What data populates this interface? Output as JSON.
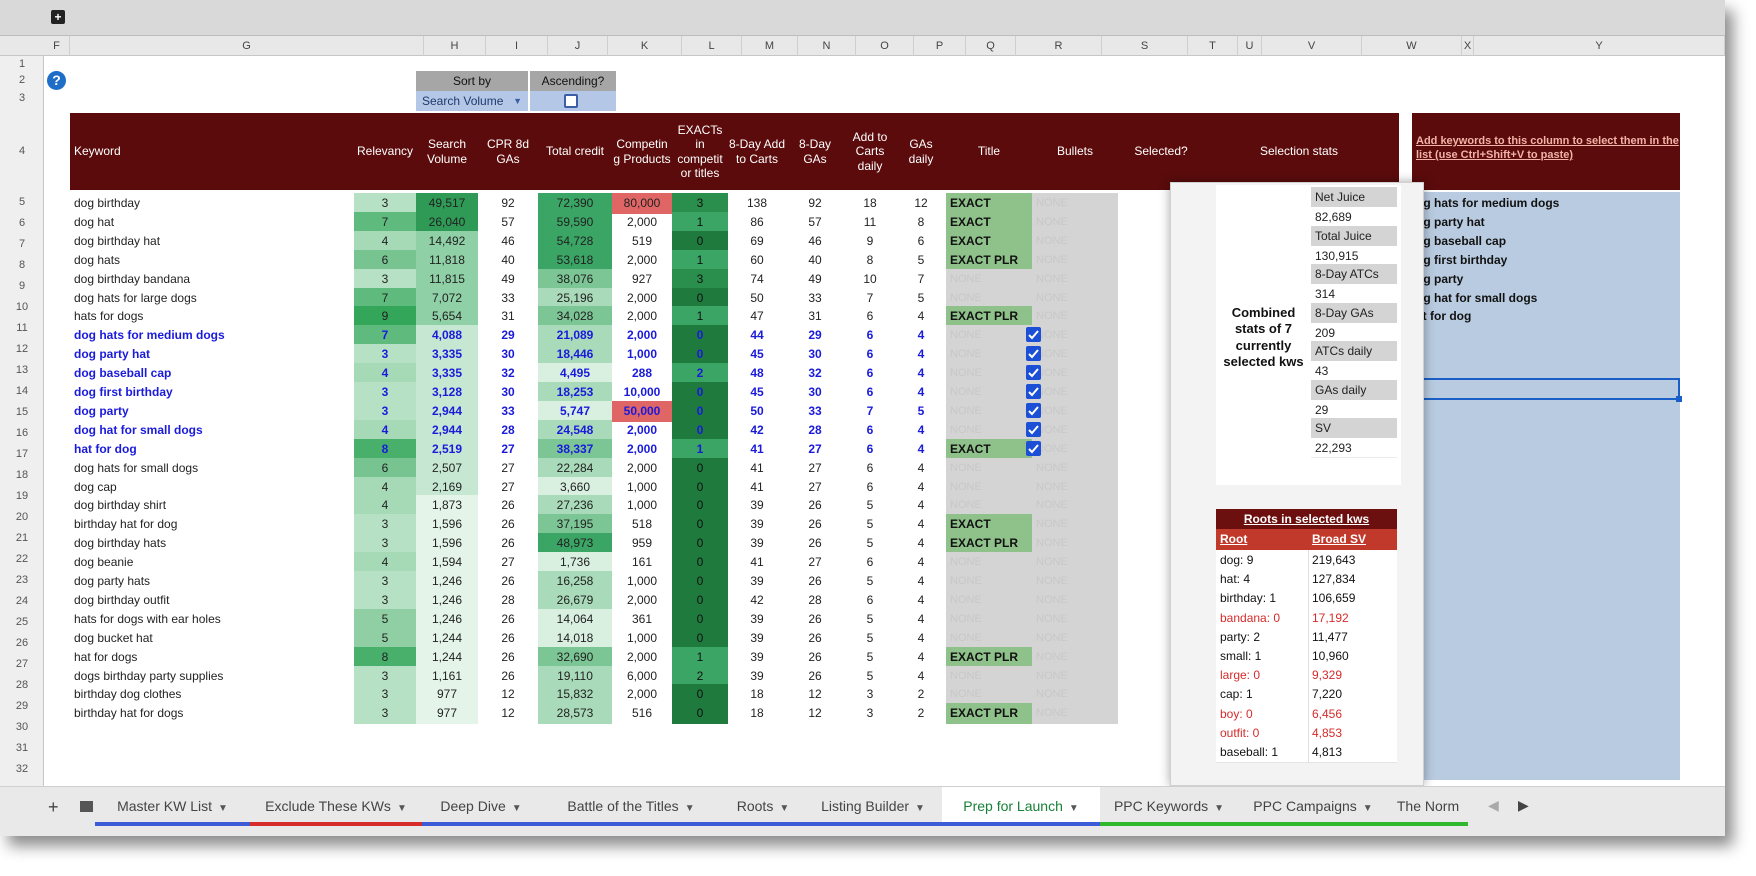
{
  "columns": [
    "F",
    "G",
    "H",
    "I",
    "J",
    "K",
    "L",
    "M",
    "N",
    "O",
    "P",
    "Q",
    "R",
    "S",
    "T",
    "U",
    "V",
    "W",
    "X",
    "Y"
  ],
  "row_numbers": [
    "1",
    "2",
    "3",
    "4",
    "5",
    "6",
    "7",
    "8",
    "9",
    "10",
    "11",
    "12",
    "13",
    "14",
    "15",
    "16",
    "17",
    "18",
    "19",
    "20",
    "21",
    "22",
    "23",
    "24",
    "25",
    "26",
    "27",
    "28",
    "29",
    "30",
    "31",
    "32"
  ],
  "sort": {
    "label": "Sort by",
    "value": "Search Volume",
    "asc_label": "Ascending?"
  },
  "headers": {
    "keyword": "Keyword",
    "relevancy": "Relevancy",
    "search_volume": "Search Volume",
    "cpr": "CPR 8d GAs",
    "total_credit": "Total credit",
    "competing": "Competin g Products",
    "exacts": "EXACTs in competit or titles",
    "atc8": "8-Day Add to Carts",
    "ga8": "8-Day GAs",
    "atc_daily": "Add to Carts daily",
    "ga_daily": "GAs daily",
    "title": "Title",
    "bullets": "Bullets",
    "selected": "Selected?",
    "selection_stats": "Selection stats"
  },
  "rows": [
    {
      "kw": "dog birthday",
      "rel": "3",
      "sv": "49,517",
      "cpr": "92",
      "tc": "72,390",
      "cp": "80,000",
      "ex": "3",
      "a8": "138",
      "g8": "92",
      "ad": "18",
      "gd": "12",
      "title": "EXACT",
      "bullets": "NONE",
      "sel": false
    },
    {
      "kw": "dog hat",
      "rel": "7",
      "sv": "26,040",
      "cpr": "57",
      "tc": "59,590",
      "cp": "2,000",
      "ex": "1",
      "a8": "86",
      "g8": "57",
      "ad": "11",
      "gd": "8",
      "title": "EXACT",
      "bullets": "NONE",
      "sel": false
    },
    {
      "kw": "dog birthday hat",
      "rel": "4",
      "sv": "14,492",
      "cpr": "46",
      "tc": "54,728",
      "cp": "519",
      "ex": "0",
      "a8": "69",
      "g8": "46",
      "ad": "9",
      "gd": "6",
      "title": "EXACT",
      "bullets": "NONE",
      "sel": false
    },
    {
      "kw": "dog hats",
      "rel": "6",
      "sv": "11,818",
      "cpr": "40",
      "tc": "53,618",
      "cp": "2,000",
      "ex": "1",
      "a8": "60",
      "g8": "40",
      "ad": "8",
      "gd": "5",
      "title": "EXACT PLR",
      "bullets": "NONE",
      "sel": false
    },
    {
      "kw": "dog birthday bandana",
      "rel": "3",
      "sv": "11,815",
      "cpr": "49",
      "tc": "38,076",
      "cp": "927",
      "ex": "3",
      "a8": "74",
      "g8": "49",
      "ad": "10",
      "gd": "7",
      "title": "NONE",
      "bullets": "NONE",
      "sel": false
    },
    {
      "kw": "dog hats for large dogs",
      "rel": "7",
      "sv": "7,072",
      "cpr": "33",
      "tc": "25,196",
      "cp": "2,000",
      "ex": "0",
      "a8": "50",
      "g8": "33",
      "ad": "7",
      "gd": "5",
      "title": "NONE",
      "bullets": "NONE",
      "sel": false
    },
    {
      "kw": "hats for dogs",
      "rel": "9",
      "sv": "5,654",
      "cpr": "31",
      "tc": "34,028",
      "cp": "2,000",
      "ex": "1",
      "a8": "47",
      "g8": "31",
      "ad": "6",
      "gd": "4",
      "title": "EXACT PLR",
      "bullets": "NONE",
      "sel": false
    },
    {
      "kw": "dog hats for medium dogs",
      "rel": "7",
      "sv": "4,088",
      "cpr": "29",
      "tc": "21,089",
      "cp": "2,000",
      "ex": "0",
      "a8": "44",
      "g8": "29",
      "ad": "6",
      "gd": "4",
      "title": "NONE",
      "bullets": "NONE",
      "sel": true
    },
    {
      "kw": "dog party hat",
      "rel": "3",
      "sv": "3,335",
      "cpr": "30",
      "tc": "18,446",
      "cp": "1,000",
      "ex": "0",
      "a8": "45",
      "g8": "30",
      "ad": "6",
      "gd": "4",
      "title": "NONE",
      "bullets": "NONE",
      "sel": true
    },
    {
      "kw": "dog baseball cap",
      "rel": "4",
      "sv": "3,335",
      "cpr": "32",
      "tc": "4,495",
      "cp": "288",
      "ex": "2",
      "a8": "48",
      "g8": "32",
      "ad": "6",
      "gd": "4",
      "title": "NONE",
      "bullets": "NONE",
      "sel": true
    },
    {
      "kw": "dog first birthday",
      "rel": "3",
      "sv": "3,128",
      "cpr": "30",
      "tc": "18,253",
      "cp": "10,000",
      "ex": "0",
      "a8": "45",
      "g8": "30",
      "ad": "6",
      "gd": "4",
      "title": "NONE",
      "bullets": "NONE",
      "sel": true
    },
    {
      "kw": "dog party",
      "rel": "3",
      "sv": "2,944",
      "cpr": "33",
      "tc": "5,747",
      "cp": "50,000",
      "ex": "0",
      "a8": "50",
      "g8": "33",
      "ad": "7",
      "gd": "5",
      "title": "NONE",
      "bullets": "NONE",
      "sel": true
    },
    {
      "kw": "dog hat for small dogs",
      "rel": "4",
      "sv": "2,944",
      "cpr": "28",
      "tc": "24,548",
      "cp": "2,000",
      "ex": "0",
      "a8": "42",
      "g8": "28",
      "ad": "6",
      "gd": "4",
      "title": "NONE",
      "bullets": "NONE",
      "sel": true
    },
    {
      "kw": "hat for dog",
      "rel": "8",
      "sv": "2,519",
      "cpr": "27",
      "tc": "38,337",
      "cp": "2,000",
      "ex": "1",
      "a8": "41",
      "g8": "27",
      "ad": "6",
      "gd": "4",
      "title": "EXACT",
      "bullets": "NONE",
      "sel": true
    },
    {
      "kw": "dog hats for small dogs",
      "rel": "6",
      "sv": "2,507",
      "cpr": "27",
      "tc": "22,284",
      "cp": "2,000",
      "ex": "0",
      "a8": "41",
      "g8": "27",
      "ad": "6",
      "gd": "4",
      "title": "NONE",
      "bullets": "NONE",
      "sel": false
    },
    {
      "kw": "dog cap",
      "rel": "4",
      "sv": "2,169",
      "cpr": "27",
      "tc": "3,660",
      "cp": "1,000",
      "ex": "0",
      "a8": "41",
      "g8": "27",
      "ad": "6",
      "gd": "4",
      "title": "NONE",
      "bullets": "NONE",
      "sel": false
    },
    {
      "kw": "dog birthday shirt",
      "rel": "4",
      "sv": "1,873",
      "cpr": "26",
      "tc": "27,236",
      "cp": "1,000",
      "ex": "0",
      "a8": "39",
      "g8": "26",
      "ad": "5",
      "gd": "4",
      "title": "NONE",
      "bullets": "NONE",
      "sel": false
    },
    {
      "kw": "birthday hat for dog",
      "rel": "3",
      "sv": "1,596",
      "cpr": "26",
      "tc": "37,195",
      "cp": "518",
      "ex": "0",
      "a8": "39",
      "g8": "26",
      "ad": "5",
      "gd": "4",
      "title": "EXACT",
      "bullets": "NONE",
      "sel": false
    },
    {
      "kw": "dog birthday hats",
      "rel": "3",
      "sv": "1,596",
      "cpr": "26",
      "tc": "48,973",
      "cp": "959",
      "ex": "0",
      "a8": "39",
      "g8": "26",
      "ad": "5",
      "gd": "4",
      "title": "EXACT PLR",
      "bullets": "NONE",
      "sel": false
    },
    {
      "kw": "dog beanie",
      "rel": "4",
      "sv": "1,594",
      "cpr": "27",
      "tc": "1,736",
      "cp": "161",
      "ex": "0",
      "a8": "41",
      "g8": "27",
      "ad": "6",
      "gd": "4",
      "title": "NONE",
      "bullets": "NONE",
      "sel": false
    },
    {
      "kw": "dog party hats",
      "rel": "3",
      "sv": "1,246",
      "cpr": "26",
      "tc": "16,258",
      "cp": "1,000",
      "ex": "0",
      "a8": "39",
      "g8": "26",
      "ad": "5",
      "gd": "4",
      "title": "NONE",
      "bullets": "NONE",
      "sel": false
    },
    {
      "kw": "dog birthday outfit",
      "rel": "3",
      "sv": "1,246",
      "cpr": "28",
      "tc": "26,679",
      "cp": "2,000",
      "ex": "0",
      "a8": "42",
      "g8": "28",
      "ad": "6",
      "gd": "4",
      "title": "NONE",
      "bullets": "NONE",
      "sel": false
    },
    {
      "kw": "hats for dogs with ear holes",
      "rel": "5",
      "sv": "1,246",
      "cpr": "26",
      "tc": "14,064",
      "cp": "361",
      "ex": "0",
      "a8": "39",
      "g8": "26",
      "ad": "5",
      "gd": "4",
      "title": "NONE",
      "bullets": "NONE",
      "sel": false
    },
    {
      "kw": "dog bucket hat",
      "rel": "5",
      "sv": "1,244",
      "cpr": "26",
      "tc": "14,018",
      "cp": "1,000",
      "ex": "0",
      "a8": "39",
      "g8": "26",
      "ad": "5",
      "gd": "4",
      "title": "NONE",
      "bullets": "NONE",
      "sel": false
    },
    {
      "kw": "hat for dogs",
      "rel": "8",
      "sv": "1,244",
      "cpr": "26",
      "tc": "32,690",
      "cp": "2,000",
      "ex": "1",
      "a8": "39",
      "g8": "26",
      "ad": "5",
      "gd": "4",
      "title": "EXACT PLR",
      "bullets": "NONE",
      "sel": false
    },
    {
      "kw": "dogs birthday party supplies",
      "rel": "3",
      "sv": "1,161",
      "cpr": "26",
      "tc": "19,110",
      "cp": "6,000",
      "ex": "2",
      "a8": "39",
      "g8": "26",
      "ad": "5",
      "gd": "4",
      "title": "NONE",
      "bullets": "NONE",
      "sel": false
    },
    {
      "kw": "birthday dog clothes",
      "rel": "3",
      "sv": "977",
      "cpr": "12",
      "tc": "15,832",
      "cp": "2,000",
      "ex": "0",
      "a8": "18",
      "g8": "12",
      "ad": "3",
      "gd": "2",
      "title": "NONE",
      "bullets": "NONE",
      "sel": false
    },
    {
      "kw": "birthday hat for dogs",
      "rel": "3",
      "sv": "977",
      "cpr": "12",
      "tc": "28,573",
      "cp": "516",
      "ex": "0",
      "a8": "18",
      "g8": "12",
      "ad": "3",
      "gd": "2",
      "title": "EXACT PLR",
      "bullets": "NONE",
      "sel": false
    }
  ],
  "stats_panel": {
    "combined": "Combined stats of 7 currently selected kws",
    "stats": [
      {
        "label": "Net Juice",
        "value": "82,689"
      },
      {
        "label": "Total Juice",
        "value": "130,915"
      },
      {
        "label": "8-Day ATCs",
        "value": "314"
      },
      {
        "label": "8-Day GAs",
        "value": "209"
      },
      {
        "label": "ATCs daily",
        "value": "43"
      },
      {
        "label": "GAs daily",
        "value": "29"
      },
      {
        "label": "SV",
        "value": "22,293"
      }
    ],
    "roots_title": "Roots in selected kws",
    "root_col": "Root",
    "broad_col": "Broad SV",
    "roots": [
      {
        "root": "dog: 9",
        "sv": "219,643",
        "red": false
      },
      {
        "root": "hat: 4",
        "sv": "127,834",
        "red": false
      },
      {
        "root": "birthday: 1",
        "sv": "106,659",
        "red": false
      },
      {
        "root": "bandana: 0",
        "sv": "17,192",
        "red": true
      },
      {
        "root": "party: 2",
        "sv": "11,477",
        "red": false
      },
      {
        "root": "small: 1",
        "sv": "10,960",
        "red": false
      },
      {
        "root": "large: 0",
        "sv": "9,329",
        "red": true
      },
      {
        "root": "cap: 1",
        "sv": "7,220",
        "red": false
      },
      {
        "root": "boy: 0",
        "sv": "6,456",
        "red": true
      },
      {
        "root": "outfit: 0",
        "sv": "4,853",
        "red": true
      },
      {
        "root": "baseball: 1",
        "sv": "4,813",
        "red": false
      }
    ]
  },
  "y_column": {
    "header": "Add keywords to this column to select them in the list (use Ctrl+Shift+V to paste)",
    "items": [
      "og hats for medium dogs",
      "og party hat",
      "og baseball cap",
      "og first birthday",
      "og party",
      "og hat for small dogs",
      "at for dog"
    ]
  },
  "tabs": [
    {
      "label": "Master KW List",
      "active": false,
      "color": "#3d5bd6"
    },
    {
      "label": "Exclude These KWs",
      "active": false,
      "color": "#d62b2b"
    },
    {
      "label": "Deep Dive",
      "active": false,
      "color": "#3d5bd6"
    },
    {
      "label": "Battle of the Titles",
      "active": false,
      "color": "#3d5bd6"
    },
    {
      "label": "Roots",
      "active": false,
      "color": "#3d5bd6"
    },
    {
      "label": "Listing Builder",
      "active": false,
      "color": "#3d5bd6"
    },
    {
      "label": "Prep for Launch",
      "active": true,
      "color": "#3d5bd6"
    },
    {
      "label": "PPC Keywords",
      "active": false,
      "color": "#2eb82e"
    },
    {
      "label": "PPC Campaigns",
      "active": false,
      "color": "#2eb82e"
    },
    {
      "label": "The Norm",
      "active": false,
      "color": "#2eb82e"
    }
  ],
  "colors": {
    "header_bg": "#5b0b0b",
    "selected_text": "#1a1adb",
    "exact_bg": "#8fc18a",
    "active_tab": "#188038"
  }
}
